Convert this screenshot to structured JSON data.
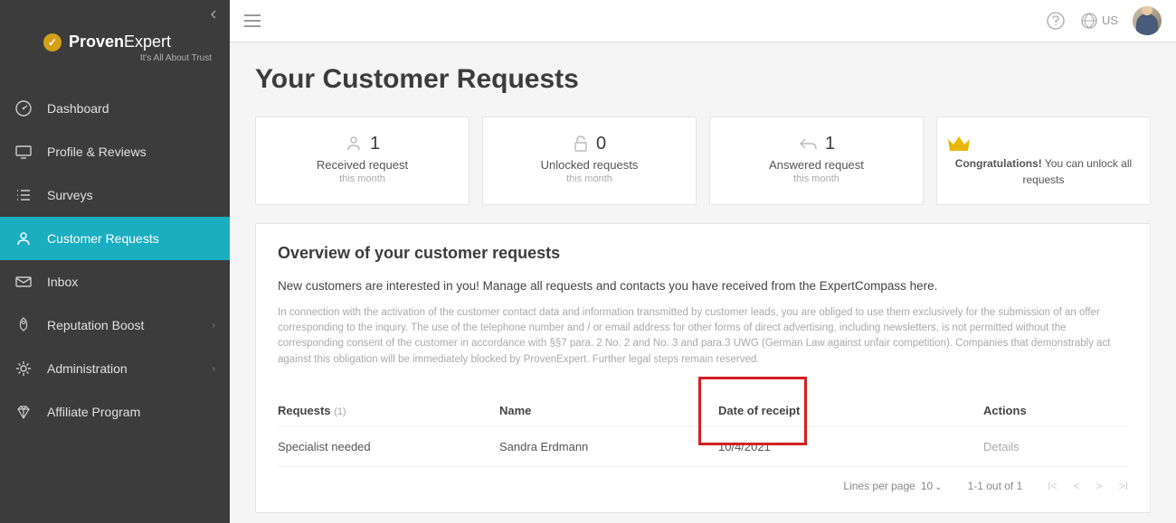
{
  "brand": {
    "name_a": "Proven",
    "name_b": "Expert",
    "tagline": "It's All About Trust"
  },
  "locale": "US",
  "sidebar": {
    "items": [
      {
        "label": "Dashboard",
        "icon": "gauge"
      },
      {
        "label": "Profile & Reviews",
        "icon": "monitor"
      },
      {
        "label": "Surveys",
        "icon": "list"
      },
      {
        "label": "Customer Requests",
        "icon": "user",
        "active": true
      },
      {
        "label": "Inbox",
        "icon": "mail"
      },
      {
        "label": "Reputation Boost",
        "icon": "rocket",
        "expandable": true
      },
      {
        "label": "Administration",
        "icon": "gear",
        "expandable": true
      },
      {
        "label": "Affiliate Program",
        "icon": "diamond"
      }
    ]
  },
  "page": {
    "title": "Your Customer Requests",
    "stats": [
      {
        "value": "1",
        "label": "Received request",
        "sub": "this month",
        "icon": "user"
      },
      {
        "value": "0",
        "label": "Unlocked requests",
        "sub": "this month",
        "icon": "lock"
      },
      {
        "value": "1",
        "label": "Answered request",
        "sub": "this month",
        "icon": "reply"
      },
      {
        "congrats_strong": "Congratulations!",
        "congrats_rest": " You can unlock all requests",
        "crown": true
      }
    ],
    "overview": {
      "title": "Overview of your customer requests",
      "desc": "New customers are interested in you! Manage all requests and contacts you have received from the ExpertCompass here.",
      "legal": "In connection with the activation of the customer contact data and information transmitted by customer leads, you are obliged to use them exclusively for the submission of an offer corresponding to the inquiry. The use of the telephone number and / or email address for other forms of direct advertising, including newsletters, is not permitted without the corresponding consent of the customer in accordance with §§7 para. 2 No. 2 and No. 3 and para.3 UWG (German Law against unfair competition). Companies that demonstrably act against this obligation will be immediately blocked by ProvenExpert. Further legal steps remain reserved."
    },
    "table": {
      "headers": {
        "requests": "Requests",
        "count": "(1)",
        "name": "Name",
        "date": "Date of receipt",
        "actions": "Actions"
      },
      "rows": [
        {
          "request": "Specialist needed",
          "name": "Sandra Erdmann",
          "date": "10/4/2021",
          "action": "Details"
        }
      ]
    },
    "pagination": {
      "lines_label": "Lines per page",
      "lines_value": "10",
      "range": "1-1 out of 1"
    }
  }
}
